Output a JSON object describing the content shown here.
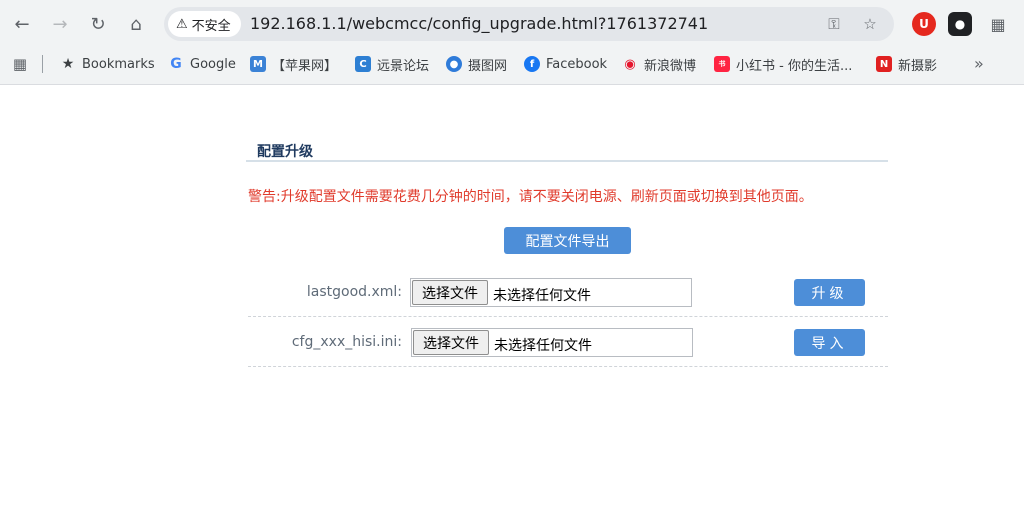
{
  "browser": {
    "security_label": "不安全",
    "url": "192.168.1.1/webcmcc/config_upgrade.html?1761372741",
    "bookmarks": [
      {
        "label": "Bookmarks",
        "icon": "star-icon"
      },
      {
        "label": "Google",
        "icon": "google-icon",
        "color": "#4285f4"
      },
      {
        "label": "【苹果网】",
        "icon": "apple-site-icon",
        "color": "#3b82d6"
      },
      {
        "label": "远景论坛",
        "icon": "pcbeta-icon",
        "color": "#2d7fd3"
      },
      {
        "label": "摄图网",
        "icon": "699pic-icon",
        "color": "#2f7bd9"
      },
      {
        "label": "Facebook",
        "icon": "facebook-icon",
        "color": "#1877f2"
      },
      {
        "label": "新浪微博",
        "icon": "weibo-icon",
        "color": "#e6162d"
      },
      {
        "label": "小红书 - 你的生活...",
        "icon": "xiaohongshu-icon",
        "color": "#ff2442"
      },
      {
        "label": "新摄影",
        "icon": "xinsheying-icon",
        "color": "#e02020"
      }
    ]
  },
  "page": {
    "section_title": "配置升级",
    "warning": "警告:升级配置文件需要花费几分钟的时间，请不要关闭电源、刷新页面或切换到其他页面。",
    "export_button": "配置文件导出",
    "rows": [
      {
        "label": "lastgood.xml:",
        "file_button": "选择文件",
        "file_status": "未选择任何文件",
        "action": "升级"
      },
      {
        "label": "cfg_xxx_hisi.ini:",
        "file_button": "选择文件",
        "file_status": "未选择任何文件",
        "action": "导入"
      }
    ]
  }
}
